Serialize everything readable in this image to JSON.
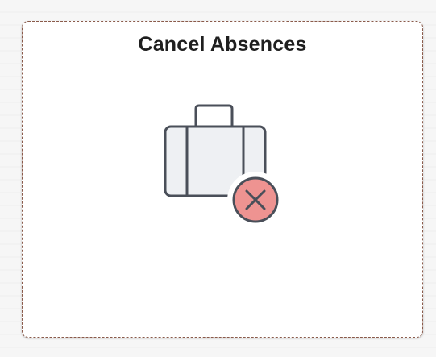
{
  "tile": {
    "title": "Cancel Absences",
    "icon": "briefcase-cancel-icon"
  },
  "colors": {
    "tile_background": "#ffffff",
    "tile_border": "#8a5a4a",
    "title_text": "#1f1f1f",
    "briefcase_fill": "#eef0f3",
    "briefcase_stroke": "#4a4f59",
    "cancel_badge_fill": "#ee9391",
    "cancel_badge_x": "#4a4f59"
  }
}
